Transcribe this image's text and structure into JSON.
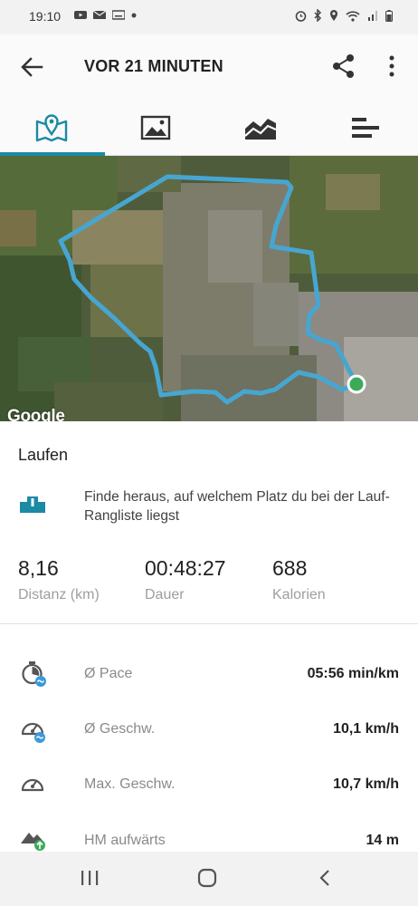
{
  "status_bar": {
    "time": "19:10"
  },
  "header": {
    "title": "VOR 21 MINUTEN"
  },
  "tabs": [
    {
      "name": "map-tab",
      "icon": "map-pin-icon",
      "active": true
    },
    {
      "name": "photos-tab",
      "icon": "image-icon",
      "active": false
    },
    {
      "name": "charts-tab",
      "icon": "area-chart-icon",
      "active": false
    },
    {
      "name": "details-tab",
      "icon": "bars-icon",
      "active": false
    }
  ],
  "map": {
    "attribution": "Google",
    "route_color": "#47a6d1",
    "endpoint_color": "#3daa5a"
  },
  "activity": {
    "type": "Laufen"
  },
  "leaderboard": {
    "text": "Finde heraus, auf welchem Platz du bei der Lauf-Rangliste liegst",
    "icon": "podium-icon",
    "badge": "1"
  },
  "summary": {
    "distance": {
      "value": "8,16",
      "label": "Distanz (km)"
    },
    "duration": {
      "value": "00:48:27",
      "label": "Dauer"
    },
    "calories": {
      "value": "688",
      "label": "Kalorien"
    }
  },
  "metrics": [
    {
      "icon": "pace-clock-icon",
      "label": "Ø Pace",
      "value": "05:56 min/km"
    },
    {
      "icon": "speedometer-avg-icon",
      "label": "Ø Geschw.",
      "value": "10,1 km/h"
    },
    {
      "icon": "speedometer-max-icon",
      "label": "Max. Geschw.",
      "value": "10,7 km/h"
    },
    {
      "icon": "elevation-up-icon",
      "label": "HM aufwärts",
      "value": "14 m"
    }
  ],
  "colors": {
    "accent": "#1a8aa5",
    "route": "#47a6d1"
  }
}
